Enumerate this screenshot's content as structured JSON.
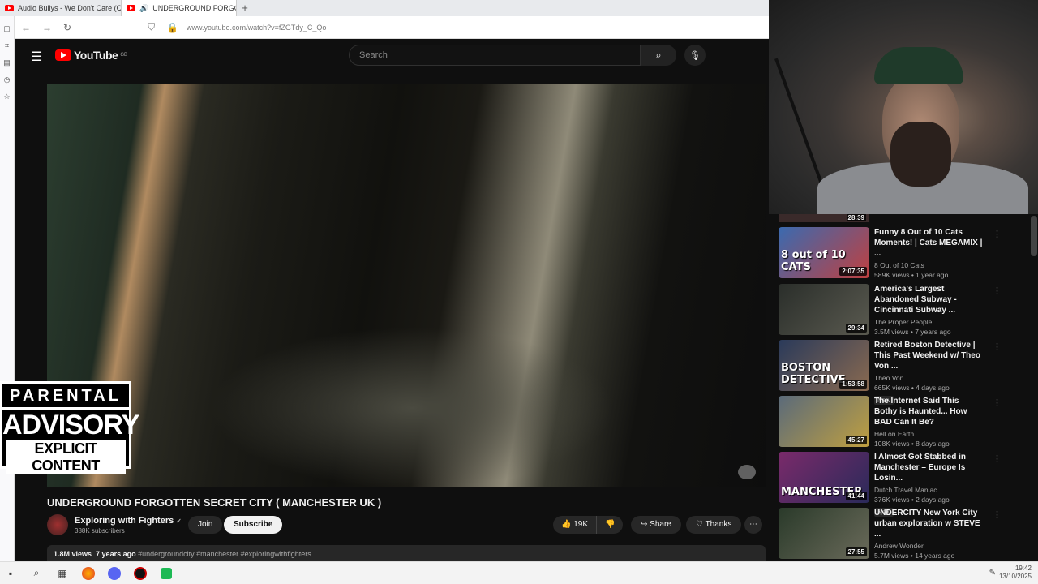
{
  "browser": {
    "tabs": [
      {
        "title": "Audio Bullys - We Don't Care (C"
      },
      {
        "title": "UNDERGROUND FORGOTTE"
      }
    ],
    "new_tab": "+",
    "close": "×",
    "url": "www.youtube.com/watch?v=fZGTdy_C_Qo"
  },
  "youtube": {
    "logo": "YouTube",
    "region": "GB",
    "search_placeholder": "Search"
  },
  "video": {
    "title": "UNDERGROUND FORGOTTEN SECRET CITY ( MANCHESTER UK )",
    "channel": "Exploring with Fighters",
    "subscribers": "388K subscribers",
    "join": "Join",
    "subscribe": "Subscribe",
    "likes": "19K",
    "share": "Share",
    "thanks": "Thanks",
    "views": "1.8M views",
    "age": "7 years ago",
    "tags": "#undergroundcity #manchester #exploringwithfighters"
  },
  "overlay": {
    "line1": "PARENTAL",
    "line2": "ADVISORY",
    "line3": "EXPLICIT CONTENT"
  },
  "sidebar": {
    "top_duration": "28:39",
    "items": [
      {
        "title": "Funny 8 Out of 10 Cats Moments! | Cats MEGAMIX | ...",
        "channel": "8 Out of 10 Cats",
        "meta": "589K views • 1 year ago",
        "duration": "2:07:35",
        "overlay": "8 out of 10 CATS",
        "thumb": "linear-gradient(135deg,#3a6ab0,#c04040)",
        "new": ""
      },
      {
        "title": "America's Largest Abandoned Subway - Cincinnati Subway ...",
        "channel": "The Proper People",
        "meta": "3.5M views • 7 years ago",
        "duration": "29:34",
        "overlay": "",
        "thumb": "linear-gradient(135deg,#2a2e2a,#5a5a50)",
        "new": ""
      },
      {
        "title": "Retired Boston Detective | This Past Weekend w/ Theo Von ...",
        "channel": "Theo Von",
        "meta": "665K views • 4 days ago",
        "duration": "1:53:58",
        "overlay": "BOSTON DETECTIVE",
        "thumb": "linear-gradient(135deg,#2a3a5a,#8a6a50)",
        "new": "New"
      },
      {
        "title": "The Internet Said This Bothy is Haunted... How BAD Can It Be?",
        "channel": "Hell on Earth",
        "meta": "108K views • 8 days ago",
        "duration": "45:27",
        "overlay": "",
        "thumb": "linear-gradient(135deg,#5a6a7a,#c0a040)",
        "new": ""
      },
      {
        "title": "I Almost Got Stabbed in Manchester – Europe Is Losin...",
        "channel": "Dutch Travel Maniac",
        "meta": "376K views • 2 days ago",
        "duration": "41:44",
        "overlay": "MANCHESTER",
        "thumb": "linear-gradient(135deg,#7a2a6a,#2a2a5a)",
        "new": "New"
      },
      {
        "title": "UNDERCITY New York City urban exploration w STEVE ...",
        "channel": "Andrew Wonder",
        "meta": "5.7M views • 14 years ago",
        "duration": "27:55",
        "overlay": "",
        "thumb": "linear-gradient(135deg,#2a3a2a,#6a6a5a)",
        "new": ""
      }
    ]
  },
  "taskbar": {
    "time": "19:42",
    "date": "13/10/2025"
  }
}
